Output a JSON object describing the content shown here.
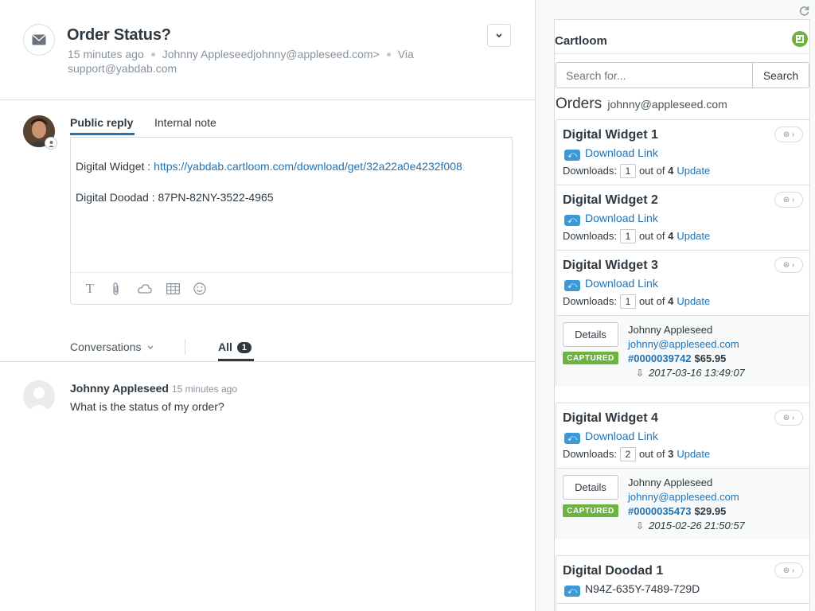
{
  "ticket": {
    "title": "Order Status?",
    "time": "15 minutes ago",
    "requester": "Johnny Appleseedjohnny@appleseed.com>",
    "via": "Via",
    "via_address": "support@yabdab.com"
  },
  "reply": {
    "tab_public": "Public reply",
    "tab_internal": "Internal note",
    "line1_label": "Digital Widget :",
    "line1_link": "https://yabdab.cartloom.com/download/get/32a22a0e4232f008",
    "line2": "Digital Doodad : 87PN-82NY-3522-4965",
    "toolbar_text_glyph": "T"
  },
  "conversations": {
    "label": "Conversations",
    "all_label": "All",
    "all_count": "1"
  },
  "message": {
    "author": "Johnny Appleseed",
    "time": "15 minutes ago",
    "body": "What is the status of my order?"
  },
  "sidebar": {
    "app_title": "Cartloom",
    "search_placeholder": "Search for...",
    "search_button": "Search",
    "orders_title": "Orders",
    "orders_email": "johnny@appleseed.com",
    "download_link_label": "Download Link",
    "downloads_label": "Downloads:",
    "out_of_label": "out of",
    "update_label": "Update",
    "details_label": "Details",
    "captured_label": "CAPTURED"
  },
  "orders": [
    {
      "items": [
        {
          "name": "Digital Widget 1",
          "downloads": "1",
          "max": "4"
        },
        {
          "name": "Digital Widget 2",
          "downloads": "1",
          "max": "4"
        },
        {
          "name": "Digital Widget 3",
          "downloads": "1",
          "max": "4"
        }
      ],
      "customer": "Johnny Appleseed",
      "email": "johnny@appleseed.com",
      "number": "#0000039742",
      "total": "$65.95",
      "date": "2017-03-16 13:49:07"
    },
    {
      "items": [
        {
          "name": "Digital Widget 4",
          "downloads": "2",
          "max": "3"
        }
      ],
      "customer": "Johnny Appleseed",
      "email": "johnny@appleseed.com",
      "number": "#0000035473",
      "total": "$29.95",
      "date": "2015-02-26 21:50:57"
    },
    {
      "items": [
        {
          "name": "Digital Doodad 1",
          "code": "N94Z-635Y-7489-729D"
        }
      ]
    }
  ],
  "colors": {
    "link": "#1f73b7",
    "captured": "#6cb33f",
    "text": "#2f3941",
    "muted": "#87929d"
  }
}
